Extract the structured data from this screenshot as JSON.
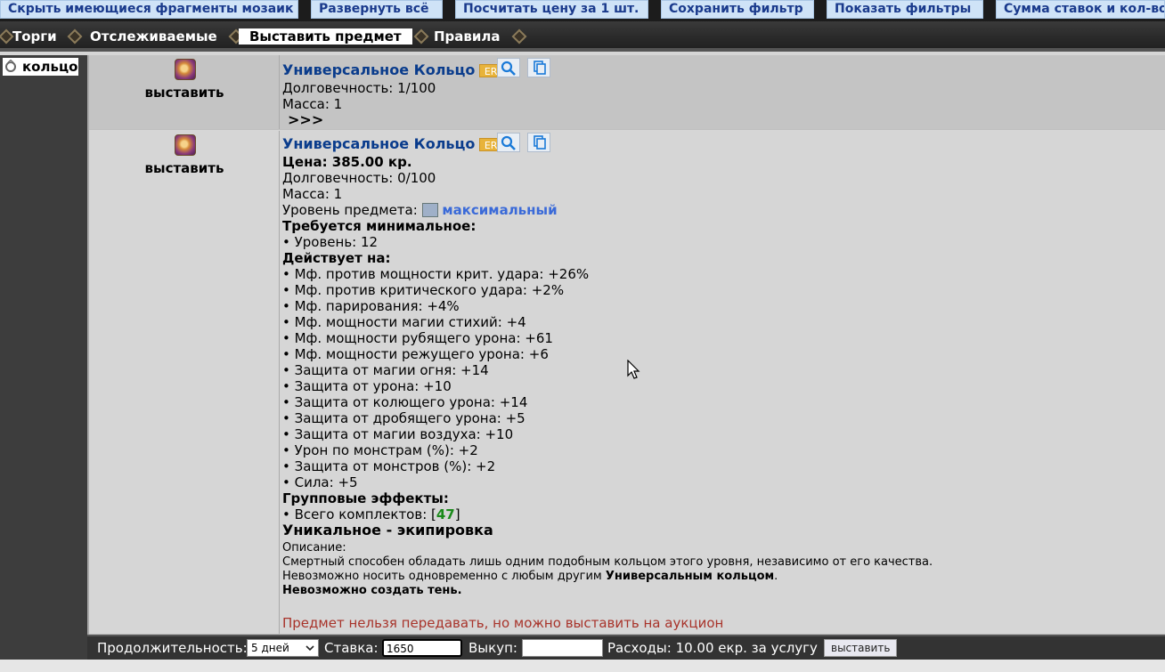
{
  "toolbar": {
    "buttons": [
      "Скрыть имеющиеся фрагменты мозаик",
      "Развернуть всё",
      "Посчитать цену за 1 шт.",
      "Сохранить фильтр",
      "Показать фильтры",
      "Сумма ставок и кол-во"
    ]
  },
  "nav": {
    "items": [
      "Торги",
      "Отслеживаемые",
      "Выставить предмет",
      "Правила"
    ],
    "active": "Выставить предмет"
  },
  "sidebar": {
    "item_label": "кольцо",
    "item_icon": "ring-icon"
  },
  "listing1": {
    "place_label": "выставить",
    "title": "Универсальное Кольцо",
    "badge": "ER",
    "durability": "Долговечность: 1/100",
    "mass": "Масса: 1",
    "expand": ">>>"
  },
  "listing2": {
    "place_label": "выставить",
    "title": "Универсальное Кольцо",
    "badge": "ER",
    "price": "Цена: 385.00 кр.",
    "durability": "Долговечность: 0/100",
    "mass": "Масса: 1",
    "level_label": "Уровень предмета:",
    "level_value": "максимальный",
    "requires_header": "Требуется минимальное:",
    "requires": [
      "• Уровень: 12"
    ],
    "effects_header": "Действует на:",
    "effects": [
      "• Мф. против мощности крит. удара: +26%",
      "• Мф. против критического удара: +2%",
      "• Мф. парирования: +4%",
      "• Мф. мощности магии стихий: +4",
      "• Мф. мощности рубящего урона: +61",
      "• Мф. мощности режущего урона: +6",
      "• Защита от магии огня: +14",
      "• Защита от урона: +10",
      "• Защита от колющего урона: +14",
      "• Защита от дробящего урона: +5",
      "• Защита от магии воздуха: +10",
      "• Урон по монстрам (%): +2",
      "• Защита от монстров (%): +2",
      "• Сила: +5"
    ],
    "group_header": "Групповые эффекты:",
    "sets_prefix": "• Всего комплектов: [",
    "sets_value": "47",
    "sets_suffix": "]",
    "unique": "Уникальное - экипировка",
    "desc_label": "Описание:",
    "desc_line1": "Смертный способен обладать лишь одним подобным кольцом этого уровня, независимо от его качества.",
    "desc_line2_prefix": "Невозможно носить одновременно с любым другим ",
    "desc_line2_bold": "Универсальным кольцом",
    "desc_line2_suffix": ".",
    "desc_line3": "Невозможно создать тень.",
    "transfer_note": "Предмет нельзя передавать, но можно выставить на аукцион"
  },
  "form": {
    "duration_label": "Продолжительность:",
    "duration_value": "5 дней",
    "bid_label": "Ставка:",
    "bid_value": "1650",
    "buyout_label": "Выкуп:",
    "buyout_value": "",
    "fee_text": "Расходы: 10.00 екр. за услугу",
    "submit_label": "выставить"
  }
}
